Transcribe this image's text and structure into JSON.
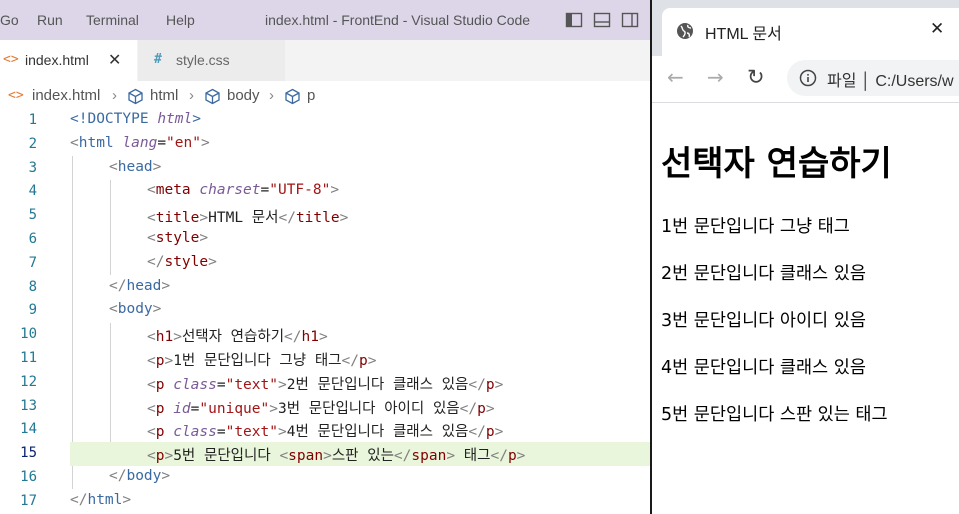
{
  "vscode": {
    "menu": [
      "Go",
      "Run",
      "Terminal",
      "Help"
    ],
    "window_title": "index.html - FrontEnd - Visual Studio Code",
    "tabs": [
      {
        "icon": "<>",
        "label": "index.html",
        "close": "✕"
      },
      {
        "icon": "#",
        "label": "style.css"
      }
    ],
    "breadcrumb": [
      "index.html",
      "html",
      "body",
      "p"
    ],
    "line_numbers": [
      "1",
      "2",
      "3",
      "4",
      "5",
      "6",
      "7",
      "8",
      "9",
      "10",
      "11",
      "12",
      "13",
      "14",
      "15",
      "16",
      "17"
    ],
    "code": {
      "l1": {
        "a": "<!DOCTYPE ",
        "b": "html",
        "c": ">"
      },
      "l2": {
        "tag": "html",
        "attr": "lang",
        "val": "\"en\""
      },
      "l3": {
        "tag": "head"
      },
      "l4": {
        "tag": "meta",
        "attr": "charset",
        "val": "\"UTF-8\""
      },
      "l5": {
        "tag": "title",
        "text": "HTML 문서"
      },
      "l6": {
        "tag": "style"
      },
      "l7": {
        "tag": "style"
      },
      "l8": {
        "tag": "head"
      },
      "l9": {
        "tag": "body"
      },
      "l10": {
        "tag": "h1",
        "text": "선택자 연습하기"
      },
      "l11": {
        "tag": "p",
        "text": "1번 문단입니다 그냥 태그"
      },
      "l12": {
        "tag": "p",
        "attr": "class",
        "val": "\"text\"",
        "text": "2번 문단입니다 클래스 있음"
      },
      "l13": {
        "tag": "p",
        "attr": "id",
        "val": "\"unique\"",
        "text": "3번 문단입니다 아이디 있음"
      },
      "l14": {
        "tag": "p",
        "attr": "class",
        "val": "\"text\"",
        "text": "4번 문단입니다 클래스 있음"
      },
      "l15": {
        "tag": "p",
        "text1": "5번 문단입니다 ",
        "span": "span",
        "text2": "스판 있는",
        "text3": " 태그"
      },
      "l16": {
        "tag": "body"
      },
      "l17": {
        "tag": "html"
      }
    }
  },
  "browser": {
    "tab_title": "HTML 문서",
    "tab_close": "✕",
    "address": "파일 │ C:/Users/w",
    "page": {
      "h1": "선택자 연습하기",
      "paragraphs": [
        "1번 문단입니다 그냥 태그",
        "2번 문단입니다 클래스 있음",
        "3번 문단입니다 아이디 있음",
        "4번 문단입니다 클래스 있음",
        "5번 문단입니다 스판 있는 태그"
      ]
    }
  },
  "colors": {
    "titlebar": "#ddd6e9",
    "current_line": "#e9f6dc",
    "line_number": "#237893",
    "tag": "#800000",
    "attribute": "#7a5a97",
    "string": "#a31515"
  }
}
